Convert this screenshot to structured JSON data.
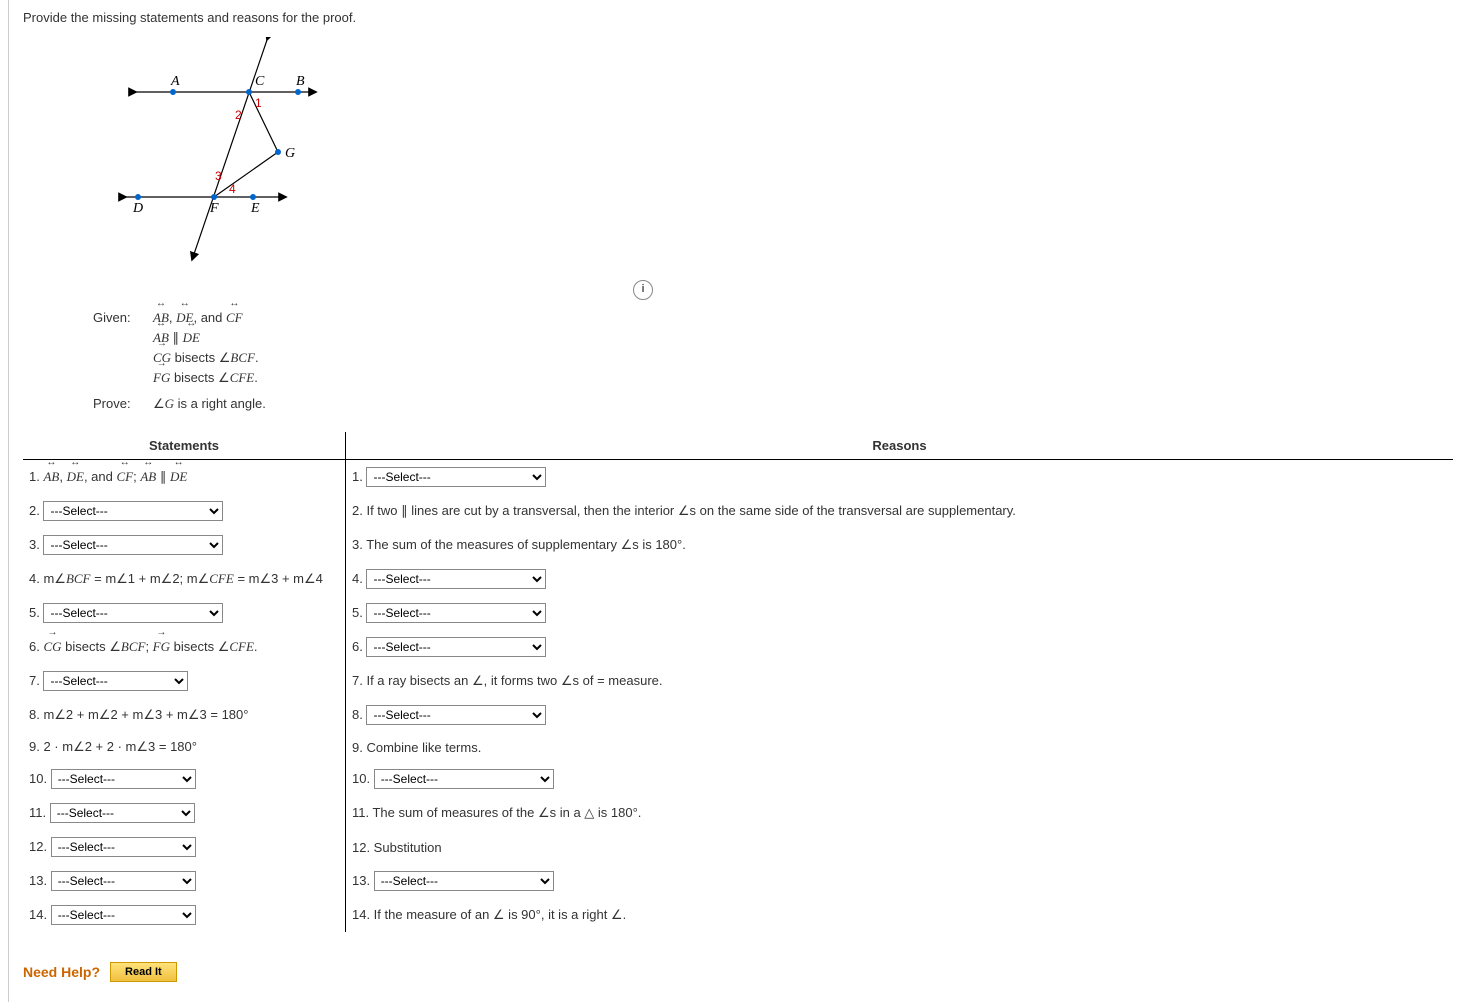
{
  "prompt": "Provide the missing statements and reasons for the proof.",
  "diagram": {
    "points": [
      "A",
      "B",
      "C",
      "D",
      "E",
      "F",
      "G"
    ],
    "angle_labels": [
      "1",
      "2",
      "3",
      "4"
    ]
  },
  "info_icon": "i",
  "given_label": "Given:",
  "prove_label": "Prove:",
  "given_lines": [
    "AB, DE, and CF",
    "AB ∥ DE",
    "CG bisects ∠BCF.",
    "FG bisects ∠CFE."
  ],
  "prove_text": "∠G is a right angle.",
  "headers": {
    "statements": "Statements",
    "reasons": "Reasons"
  },
  "select_placeholder": "---Select---",
  "rows": [
    {
      "n": "1",
      "stmt_text": "AB, DE, and CF; AB ∥ DE",
      "stmt_select": false,
      "reason_select": true
    },
    {
      "n": "2",
      "stmt_select": true,
      "reason_text": "If two ∥ lines are cut by a transversal, then the interior ∠s on the same side of the transversal are supplementary."
    },
    {
      "n": "3",
      "stmt_select": true,
      "reason_text": "The sum of the measures of supplementary ∠s is 180°."
    },
    {
      "n": "4",
      "stmt_text": "m∠BCF = m∠1 + m∠2; m∠CFE = m∠3 + m∠4",
      "reason_select": true
    },
    {
      "n": "5",
      "stmt_select": true,
      "reason_select": true
    },
    {
      "n": "6",
      "stmt_text": "CG bisects ∠BCF; FG bisects ∠CFE.",
      "reason_select": true
    },
    {
      "n": "7",
      "stmt_select": true,
      "stmt_select_small": true,
      "reason_text": "If a ray bisects an ∠, it forms two ∠s of = measure."
    },
    {
      "n": "8",
      "stmt_text": "m∠2 + m∠2 + m∠3 + m∠3 = 180°",
      "reason_select": true
    },
    {
      "n": "9",
      "stmt_text": "2 · m∠2 + 2 · m∠3 = 180°",
      "reason_text": "Combine like terms."
    },
    {
      "n": "10",
      "stmt_select": true,
      "stmt_select_small": true,
      "reason_select": true
    },
    {
      "n": "11",
      "stmt_select": true,
      "stmt_select_small": true,
      "reason_text": "The sum of measures of the ∠s in a △ is 180°."
    },
    {
      "n": "12",
      "stmt_select": true,
      "stmt_select_small": true,
      "reason_text": "Substitution"
    },
    {
      "n": "13",
      "stmt_select": true,
      "stmt_select_small": true,
      "reason_select": true
    },
    {
      "n": "14",
      "stmt_select": true,
      "stmt_select_small": true,
      "reason_text": "If the measure of an ∠ is 90°, it is a right ∠."
    }
  ],
  "need_help": {
    "label": "Need Help?",
    "button": "Read It"
  }
}
